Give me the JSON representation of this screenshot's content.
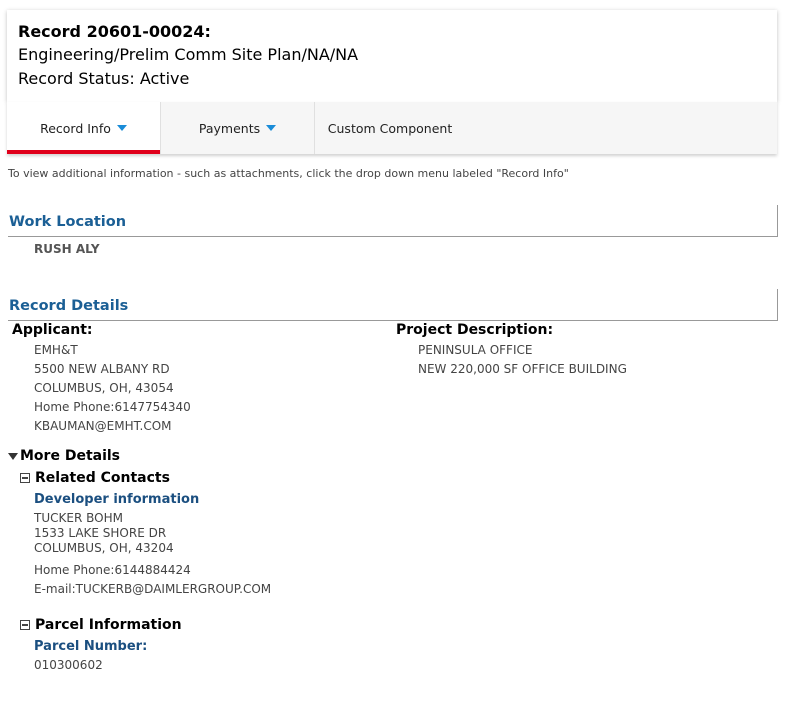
{
  "record": {
    "title": "Record 20601-00024:",
    "type": "Engineering/Prelim Comm Site Plan/NA/NA",
    "status": "Record Status: Active"
  },
  "tabs": [
    {
      "label": "Record Info",
      "dropdown": true,
      "active": true
    },
    {
      "label": "Payments",
      "dropdown": true,
      "active": false
    },
    {
      "label": "Custom Component",
      "dropdown": false,
      "active": false
    }
  ],
  "hint": "To view additional information - such as attachments, click the drop down menu labeled \"Record Info\"",
  "work_location": {
    "heading": "Work Location",
    "address": "RUSH ALY"
  },
  "record_details": {
    "heading": "Record Details",
    "applicant": {
      "label": "Applicant:",
      "lines": [
        "EMH&T",
        "5500 NEW ALBANY RD",
        "COLUMBUS, OH, 43054",
        "Home Phone:6147754340",
        "KBAUMAN@EMHT.COM"
      ]
    },
    "project": {
      "label": "Project Description:",
      "lines": [
        "PENINSULA OFFICE",
        "NEW 220,000 SF OFFICE BUILDING"
      ]
    }
  },
  "more_details": {
    "label": "More Details",
    "related_contacts": {
      "label": "Related Contacts",
      "contact_type": "Developer information",
      "name": "TUCKER BOHM",
      "street": "1533 LAKE SHORE DR",
      "city": "COLUMBUS, OH, 43204",
      "phone": "Home Phone:6144884424",
      "email": "E-mail:TUCKERB@DAIMLERGROUP.COM"
    },
    "parcel": {
      "label": "Parcel Information",
      "number_label": "Parcel Number:",
      "number": "010300602"
    }
  },
  "colors": {
    "accent_red": "#e0001b",
    "heading_blue": "#1b5f95",
    "caret_blue": "#1a8cd8"
  }
}
